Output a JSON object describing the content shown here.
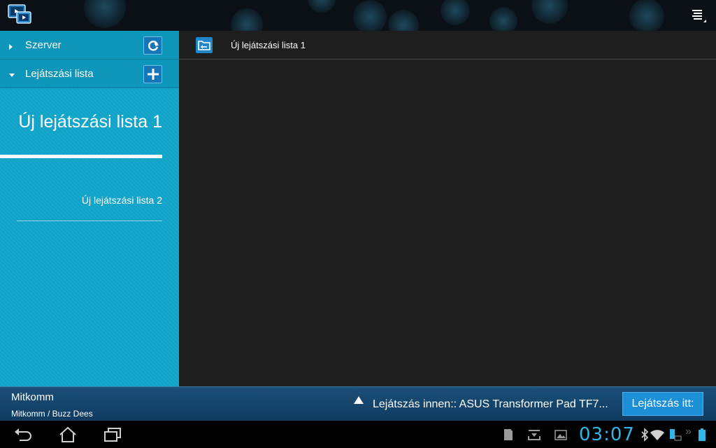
{
  "app": {
    "icon": "media-player-icon",
    "menu_icon": "overflow-menu-icon"
  },
  "sidebar": {
    "sections": [
      {
        "label": "Szerver",
        "action_icon": "refresh-icon",
        "expanded": false
      },
      {
        "label": "Lejátszási lista",
        "action_icon": "add-icon",
        "expanded": true
      }
    ],
    "playlists": [
      {
        "label": "Új lejátszási lista 1",
        "selected": true
      },
      {
        "label": "Új lejátszási lista 2",
        "selected": false
      }
    ]
  },
  "main": {
    "back_icon": "back-folder-icon",
    "title": "Új lejátszási lista 1"
  },
  "now_playing": {
    "track": "Mitkomm",
    "artist_album": "Mitkomm / Buzz Dees",
    "source": "Lejátszás innen:: ASUS Transformer Pad TF7...",
    "play_to_label": "Lejátszás itt:"
  },
  "system_bar": {
    "clock": "03:07",
    "nav": [
      "back-icon",
      "home-icon",
      "recent-apps-icon"
    ],
    "status_icons": [
      "sd-card-icon",
      "download-icon",
      "image-icon",
      "bluetooth-icon",
      "wifi-icon",
      "keyboard-dock-battery-icon",
      "battery-icon"
    ]
  },
  "colors": {
    "sidebar": "#11a5cc",
    "sidebar_header": "#0e95ba",
    "accent": "#33b5e5",
    "nowbar": "#1b4f78",
    "main_bg": "#1e1e1e"
  }
}
